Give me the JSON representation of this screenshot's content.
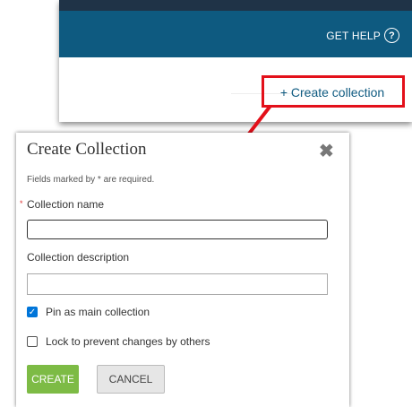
{
  "header": {
    "get_help_label": "GET HELP",
    "help_icon_glyph": "?",
    "create_link_label": "+ Create collection"
  },
  "dialog": {
    "title": "Create Collection",
    "close_glyph": "✖",
    "required_note": "Fields marked by * are required.",
    "required_star": "*",
    "name_label": "Collection name",
    "name_value": "",
    "description_label": "Collection description",
    "description_value": "",
    "pin": {
      "label": "Pin as main collection",
      "checked": true
    },
    "lock": {
      "label": "Lock to prevent changes by others",
      "checked": false
    },
    "create_button": "CREATE",
    "cancel_button": "CANCEL"
  },
  "colors": {
    "header_bg": "#0e5a80",
    "top_bar": "#1f3347",
    "highlight": "#e3101a",
    "create_button_bg": "#7dbb45",
    "checkbox_blue": "#0075d9"
  },
  "icons": {
    "help": "question-circle-icon",
    "close": "close-icon",
    "arrow": "red-callout-arrow"
  }
}
